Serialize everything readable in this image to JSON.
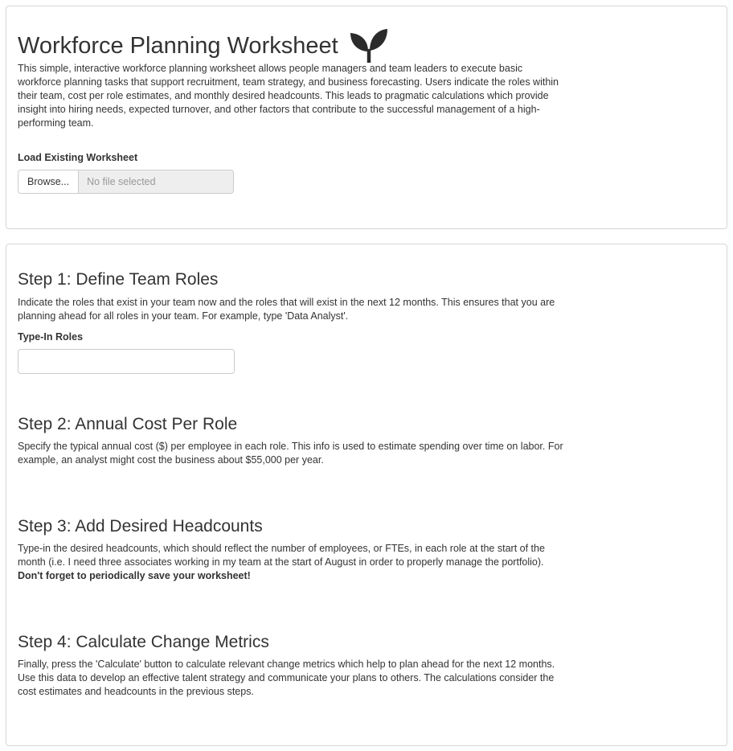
{
  "header": {
    "title": "Workforce Planning Worksheet",
    "intro": "This simple, interactive workforce planning worksheet allows people managers and team leaders to execute basic workforce planning tasks that support recruitment, team strategy, and business forecasting. Users indicate the roles within their team, cost per role estimates, and monthly desired headcounts. This leads to pragmatic calculations which provide insight into hiring needs, expected turnover, and other factors that contribute to the successful management of a high-performing team."
  },
  "load": {
    "label": "Load Existing Worksheet",
    "browse_label": "Browse...",
    "file_status": "No file selected"
  },
  "step1": {
    "title": "Step 1: Define Team Roles",
    "description": "Indicate the roles that exist in your team now and the roles that will exist in the next 12 months. This ensures that you are planning ahead for all roles in your team. For example, type 'Data Analyst'.",
    "input_label": "Type-In Roles",
    "input_value": ""
  },
  "step2": {
    "title": "Step 2: Annual Cost Per Role",
    "description": "Specify the typical annual cost ($) per employee in each role. This info is used to estimate spending over time on labor. For example, an analyst might cost the business about $55,000 per year."
  },
  "step3": {
    "title": "Step 3: Add Desired Headcounts",
    "description": "Type-in the desired headcounts, which should reflect the number of employees, or FTEs, in each role at the start of the month (i.e. I need three associates working in my team at the start of August in order to properly manage the portfolio).",
    "reminder": "Don't forget to periodically save your worksheet!"
  },
  "step4": {
    "title": "Step 4: Calculate Change Metrics",
    "description": "Finally, press the 'Calculate' button to calculate relevant change metrics which help to plan ahead for the next 12 months. Use this data to develop an effective talent strategy and communicate your plans to others. The calculations consider the cost estimates and headcounts in the previous steps."
  },
  "icons": {
    "logo": "seedling-icon"
  },
  "colors": {
    "text": "#333333",
    "border": "#d6d6d6",
    "input_disabled_bg": "#eeeeee",
    "placeholder": "#999999"
  }
}
